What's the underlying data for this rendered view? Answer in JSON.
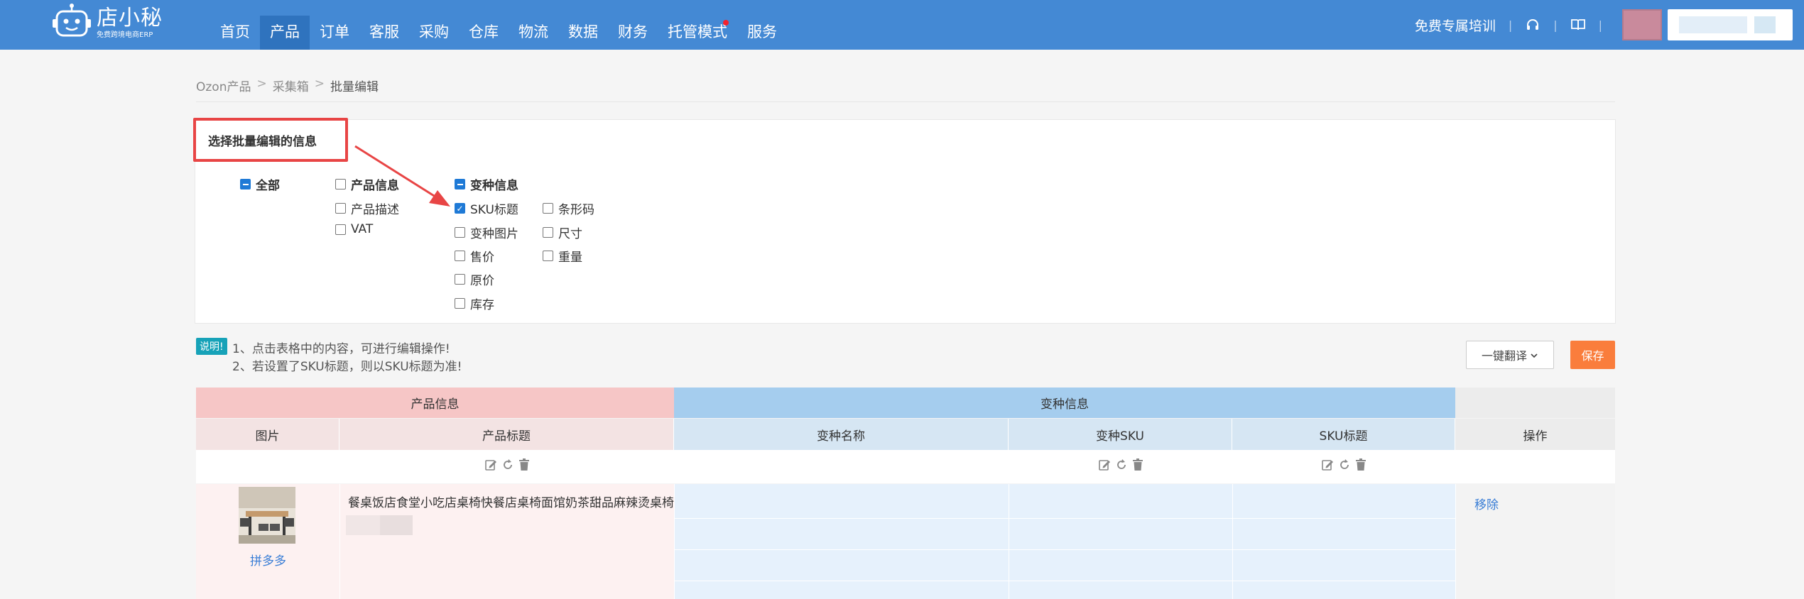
{
  "app": {
    "logo_name": "店小秘",
    "logo_sub": "免费跨境电商ERP"
  },
  "nav": {
    "items": [
      "首页",
      "产品",
      "订单",
      "客服",
      "采购",
      "仓库",
      "物流",
      "数据",
      "财务",
      "托管模式",
      "服务"
    ],
    "active": "产品"
  },
  "topbar": {
    "training_link": "免费专属培训"
  },
  "breadcrumb": [
    "Ozon产品",
    "采集箱",
    "批量编辑"
  ],
  "select_panel": {
    "title": "选择批量编辑的信息",
    "all_label": "全部",
    "product_info": {
      "label": "产品信息",
      "options": [
        "产品描述",
        "VAT"
      ]
    },
    "variant_info": {
      "label": "变种信息",
      "col1": [
        "SKU标题",
        "变种图片",
        "售价",
        "原价",
        "库存"
      ],
      "col2": [
        "条形码",
        "尺寸",
        "重量"
      ],
      "checked": "SKU标题"
    }
  },
  "notes": {
    "badge": "说明!",
    "line1": "1、点击表格中的内容，可进行编辑操作!",
    "line2": "2、若设置了SKU标题，则以SKU标题为准!"
  },
  "actions": {
    "translate": "一键翻译",
    "save": "保存"
  },
  "table": {
    "group_headers": {
      "product": "产品信息",
      "variant": "变种信息"
    },
    "columns": {
      "image": "图片",
      "product_title": "产品标题",
      "variant_name": "变种名称",
      "variant_sku": "变种SKU",
      "sku_title": "SKU标题",
      "operation": "操作"
    },
    "rows": [
      {
        "source": "拼多多",
        "product_title": "餐桌饭店食堂小吃店桌椅快餐店桌椅面馆奶茶甜品麻辣烫桌椅",
        "action": "移除"
      }
    ]
  },
  "colors": {
    "topbar": "#4489d4",
    "active_nav": "#2f73be",
    "checkbox_checked": "#1f7ad6",
    "save_button": "#fa7d3c",
    "annotation_red": "#e84545",
    "product_group": "#f6c6c6",
    "variant_group": "#a5cdee"
  }
}
